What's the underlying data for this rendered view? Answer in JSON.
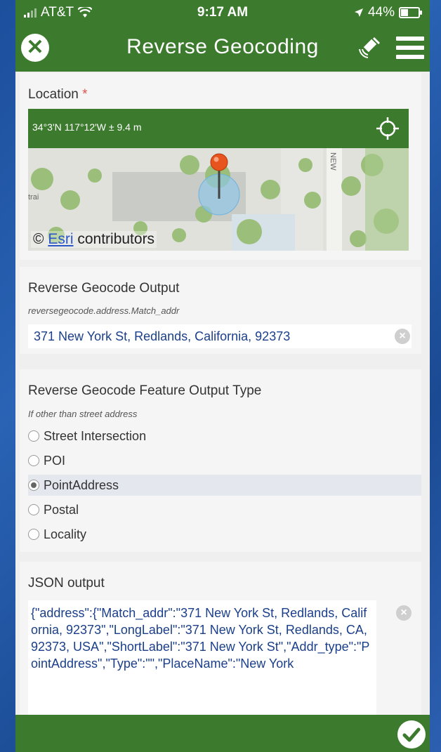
{
  "status_bar": {
    "carrier": "AT&T",
    "time": "9:17 AM",
    "battery": "44%"
  },
  "header": {
    "title": "Reverse Geocoding"
  },
  "location": {
    "label": "Location",
    "required_mark": "*",
    "coordinates": "34°3'N 117°12'W ± 9.4 m",
    "map_street_label": "NEW",
    "map_left_label": "trai",
    "attribution_prefix": "©",
    "attribution_link": "Esri",
    "attribution_suffix": "contributors"
  },
  "reverse_geocode_output": {
    "label": "Reverse Geocode Output",
    "hint": "reversegeocode.address.Match_addr",
    "value": "371 New York St, Redlands, California, 92373"
  },
  "feature_output_type": {
    "label": "Reverse Geocode Feature Output Type",
    "hint": "If other than street address",
    "options": [
      {
        "label": "Street Intersection",
        "selected": false
      },
      {
        "label": "POI",
        "selected": false
      },
      {
        "label": "PointAddress",
        "selected": true
      },
      {
        "label": "Postal",
        "selected": false
      },
      {
        "label": "Locality",
        "selected": false
      }
    ]
  },
  "json_output": {
    "label": "JSON output",
    "value": "{\"address\":{\"Match_addr\":\"371 New York St, Redlands, California, 92373\",\"LongLabel\":\"371 New York St, Redlands, CA, 92373, USA\",\"ShortLabel\":\"371 New York St\",\"Addr_type\":\"PointAddress\",\"Type\":\"\",\"PlaceName\":\"New York"
  },
  "colors": {
    "brand_green": "#3c7a2d",
    "link_blue": "#2a56c6",
    "value_blue": "#1b3f8a"
  }
}
